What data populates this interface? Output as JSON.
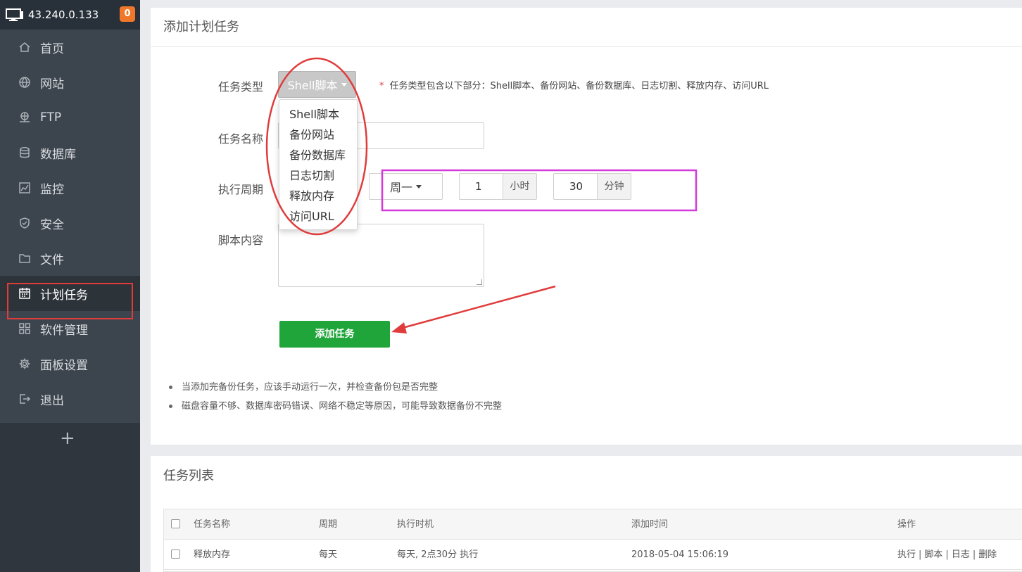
{
  "sidebar": {
    "ip": "43.240.0.133",
    "badge": "0",
    "items": [
      {
        "label": "首页",
        "icon": "home-icon"
      },
      {
        "label": "网站",
        "icon": "globe-icon"
      },
      {
        "label": "FTP",
        "icon": "ftp-icon"
      },
      {
        "label": "数据库",
        "icon": "database-icon"
      },
      {
        "label": "监控",
        "icon": "monitor-chart-icon"
      },
      {
        "label": "安全",
        "icon": "shield-icon"
      },
      {
        "label": "文件",
        "icon": "folder-icon"
      },
      {
        "label": "计划任务",
        "icon": "calendar-icon",
        "active": true
      },
      {
        "label": "软件管理",
        "icon": "grid-icon"
      },
      {
        "label": "面板设置",
        "icon": "gear-icon"
      },
      {
        "label": "退出",
        "icon": "logout-icon"
      }
    ],
    "plus": "+"
  },
  "form": {
    "title": "添加计划任务",
    "type_label": "任务类型",
    "type_value": "Shell脚本",
    "type_hint_star": "*",
    "type_hint": "任务类型包含以下部分：Shell脚本、备份网站、备份数据库、日志切割、释放内存、访问URL",
    "type_options": [
      "Shell脚本",
      "备份网站",
      "备份数据库",
      "日志切割",
      "释放内存",
      "访问URL"
    ],
    "name_label": "任务名称",
    "name_value": "",
    "cycle_label": "执行周期",
    "cycle_week": "周一",
    "hour_value": "1",
    "hour_unit": "小时",
    "minute_value": "30",
    "minute_unit": "分钟",
    "script_label": "脚本内容",
    "script_value": "",
    "add_button": "添加任务",
    "notes": [
      "当添加完备份任务，应该手动运行一次，并检查备份包是否完整",
      "磁盘容量不够、数据库密码错误、网络不稳定等原因，可能导致数据备份不完整"
    ]
  },
  "tasks": {
    "title": "任务列表",
    "columns": [
      "任务名称",
      "周期",
      "执行时机",
      "添加时间",
      "操作"
    ],
    "rows": [
      {
        "name": "释放内存",
        "cycle": "每天",
        "timing": "每天, 2点30分 执行",
        "added": "2018-05-04 15:06:19",
        "ops": [
          "执行",
          "脚本",
          "日志",
          "删除"
        ]
      }
    ],
    "op_separator": "|"
  },
  "colors": {
    "sidebar_bg": "#3c444d",
    "accent_green": "#20a53a",
    "badge_orange": "#f0772a",
    "annotation_red": "#e03c3c",
    "annotation_magenta": "#d33ad9"
  }
}
